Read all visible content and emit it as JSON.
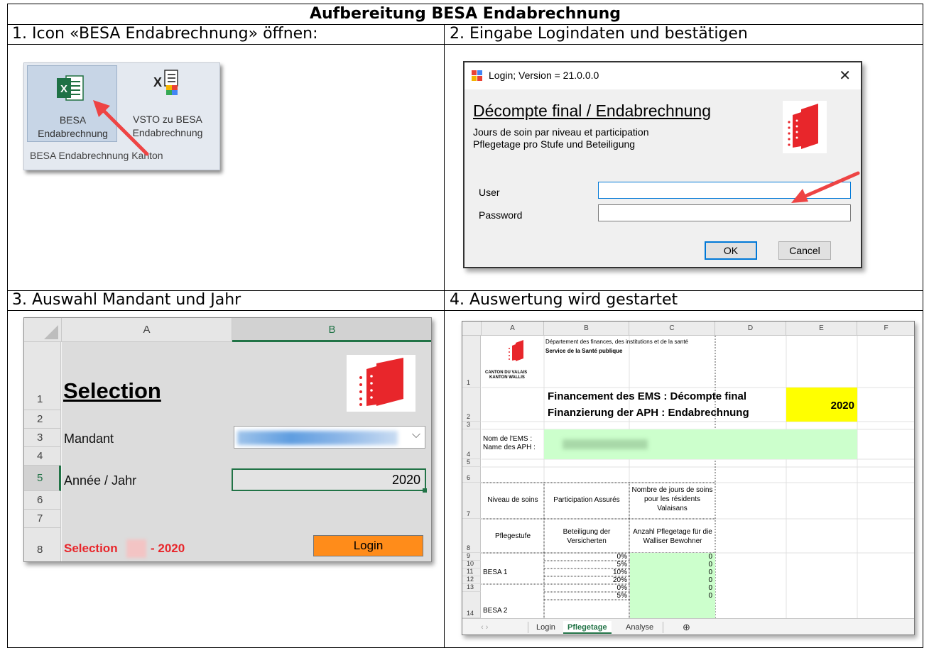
{
  "doc": {
    "title": "Aufbereitung BESA Endabrechnung",
    "steps": [
      "1. Icon «BESA Endabrechnung» öffnen:",
      "2. Eingabe Logindaten und bestätigen",
      "3. Auswahl Mandant und Jahr",
      "4. Auswertung wird gestartet"
    ]
  },
  "ribbon": {
    "button1_line1": "BESA",
    "button1_line2": "Endabrechnung",
    "button2_line1": "VSTO zu BESA",
    "button2_line2": "Endabrechnung",
    "group_label": "BESA Endabrechnung Kanton",
    "icon_letter": "X"
  },
  "login_dialog": {
    "title": "Login; Version = 21.0.0.0",
    "close_glyph": "✕",
    "heading": "Décompte final / Endabrechnung",
    "subtitle_fr": "Jours de soin par niveau et participation",
    "subtitle_de": "Pflegetage pro Stufe und Beteiligung",
    "user_label": "User",
    "password_label": "Password",
    "user_value": "",
    "password_value": "",
    "ok_label": "OK",
    "cancel_label": "Cancel"
  },
  "selection_sheet": {
    "col_a": "A",
    "col_b": "B",
    "rows": [
      "1",
      "2",
      "3",
      "4",
      "5",
      "6",
      "7",
      "8"
    ],
    "title": "Selection",
    "mandant_label": "Mandant",
    "year_label": "Année / Jahr",
    "year_value": "2020",
    "login_button": "Login",
    "footer_left": "Selection",
    "footer_right": "- 2020",
    "dropdown_glyph": "⌵"
  },
  "worksheet": {
    "columns": [
      "A",
      "B",
      "C",
      "D",
      "E",
      "F"
    ],
    "rows": [
      "1",
      "2",
      "3",
      "4",
      "5",
      "6",
      "7",
      "8",
      "9",
      "10",
      "11",
      "12",
      "13",
      "14"
    ],
    "dept_line1": "Département des finances, des institutions et de la santé",
    "dept_line2": "Service de la Santé publique",
    "canton_line1": "CANTON DU VALAIS",
    "canton_line2": "KANTON WALLIS",
    "heading_fr": "Financement des EMS : Décompte final",
    "heading_de": "Finanzierung der APH : Endabrechnung",
    "year": "2020",
    "name_label_fr": "Nom de l'EMS :",
    "name_label_de": "Name des APH :",
    "hdr_niveau": "Niveau de soins",
    "hdr_participation": "Participation Assurés",
    "hdr_jours": "Nombre de jours de soins pour les résidents Valaisans",
    "hdr_pflegestufe": "Pflegestufe",
    "hdr_beteiligung": "Beteiligung der Versicherten",
    "hdr_anzahl": "Anzahl Pflegetage für die Walliser Bewohner",
    "besa1": "BESA 1",
    "besa2": "BESA 2",
    "data_rows": [
      {
        "pct": "0%",
        "val": "0"
      },
      {
        "pct": "5%",
        "val": "0"
      },
      {
        "pct": "10%",
        "val": "0"
      },
      {
        "pct": "20%",
        "val": "0"
      },
      {
        "pct": "0%",
        "val": "0"
      },
      {
        "pct": "5%",
        "val": "0"
      }
    ],
    "tabs": [
      "Login",
      "Pflegetage",
      "Analyse"
    ],
    "active_tab": "Pflegetage",
    "add_tab_glyph": "⊕",
    "nav_glyphs": "‹   ›"
  },
  "colors": {
    "excel_green": "#217346",
    "canton_red": "#e8262b",
    "login_orange": "#ff8c1a",
    "year_yellow": "#ffff00",
    "input_green": "#ccffcc",
    "arrow_red": "#e44"
  }
}
